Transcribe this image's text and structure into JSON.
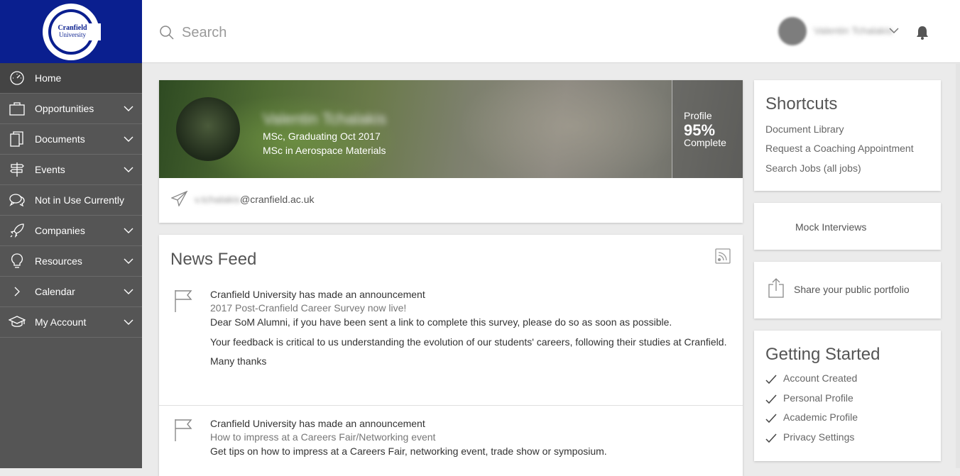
{
  "logo": {
    "line1": "Cranfield",
    "line2": "University"
  },
  "sidebar": {
    "items": [
      {
        "label": "Home",
        "icon": "speedometer-icon",
        "expandable": false
      },
      {
        "label": "Opportunities",
        "icon": "briefcase-icon",
        "expandable": true
      },
      {
        "label": "Documents",
        "icon": "documents-icon",
        "expandable": true
      },
      {
        "label": "Events",
        "icon": "signpost-icon",
        "expandable": true
      },
      {
        "label": "Not in Use Currently",
        "icon": "chat-bubbles-icon",
        "expandable": false
      },
      {
        "label": "Companies",
        "icon": "rocket-icon",
        "expandable": true
      },
      {
        "label": "Resources",
        "icon": "lightbulb-icon",
        "expandable": true
      },
      {
        "label": "Calendar",
        "icon": "chevron-right-icon",
        "expandable": true
      },
      {
        "label": "My Account",
        "icon": "graduation-cap-icon",
        "expandable": true
      }
    ]
  },
  "header": {
    "search_placeholder": "Search",
    "user_name": "Valentin Tchalakis"
  },
  "profile": {
    "name": "Valentin Tchalakis",
    "degree_line1": "MSc, Graduating Oct 2017",
    "degree_line2": "MSc in Aerospace Materials",
    "complete_label1": "Profile",
    "complete_percent": "95%",
    "complete_label2": "Complete",
    "email_user": "v.tchalakis",
    "email_domain": "@cranfield.ac.uk"
  },
  "news": {
    "title": "News Feed",
    "items": [
      {
        "heading": "Cranfield University has made an announcement",
        "link": "2017 Post-Cranfield Career Survey now live!",
        "lines": [
          "Dear SoM Alumni, if you have been sent a link to complete this survey, please do so as soon as possible.",
          "Your feedback is critical to us understanding the evolution of our students' careers, following their studies at Cranfield.",
          "Many thanks"
        ]
      },
      {
        "heading": "Cranfield University has made an announcement",
        "link": "How to impress at a Careers Fair/Networking event",
        "lines": [
          "Get tips on how to impress at a Careers Fair, networking event, trade show or symposium."
        ]
      }
    ]
  },
  "shortcuts": {
    "title": "Shortcuts",
    "links": [
      "Document Library",
      "Request a Coaching Appointment",
      "Search Jobs (all jobs)"
    ]
  },
  "mock_interviews": {
    "label": "Mock Interviews"
  },
  "share_portfolio": {
    "label": "Share your public portfolio"
  },
  "getting_started": {
    "title": "Getting Started",
    "items": [
      "Account Created",
      "Personal Profile",
      "Academic Profile",
      "Privacy Settings"
    ]
  },
  "colors": {
    "sidebar": "#555555",
    "logo_bg": "#0a1f8f",
    "active_nav": "#444444"
  }
}
